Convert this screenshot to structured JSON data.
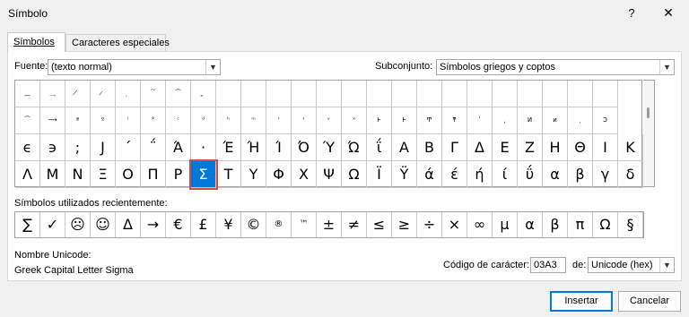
{
  "window": {
    "title": "Símbolo",
    "help": "?",
    "close": "✕"
  },
  "tabs": [
    {
      "label": "Símbolos"
    },
    {
      "label": "Caracteres especiales"
    }
  ],
  "font": {
    "label": "Fuente:",
    "value": "(texto normal)"
  },
  "subset": {
    "label": "Subconjunto:",
    "value": "Símbolos griegos y coptos"
  },
  "grid": {
    "rows": [
      [
        "͟",
        "͢",
        "̸",
        "̷",
        "̹",
        "͠",
        "͡",
        "̪",
        "",
        "",
        "",
        "",
        "",
        "",
        "",
        "",
        "",
        "",
        "",
        "",
        "",
        "",
        "",
        ""
      ],
      [
        "⁀",
        "⟶",
        "ª",
        "º",
        "ⁱ",
        "°",
        "ᶜ",
        "ᵈ",
        "ʰ",
        "ᵐ",
        "ʳ",
        "ᵗ",
        "ᵛ",
        "ˣ",
        "Ⱶ",
        "Ⱶ",
        "Ͳ",
        "ͳ",
        "ʹ",
        "͵",
        "Ͷ",
        "ͷ",
        "ͺ",
        "Ͻ"
      ],
      [
        "ϵ",
        "϶",
        ";",
        "Ϳ",
        "΄",
        "΅",
        "Ά",
        "·",
        "Έ",
        "Ή",
        "Ί",
        "Ό",
        "Ύ",
        "Ώ",
        "ΐ",
        "Α",
        "Β",
        "Γ",
        "Δ",
        "Ε",
        "Ζ",
        "Η",
        "Θ",
        "Ι",
        "Κ"
      ],
      [
        "Λ",
        "Μ",
        "Ν",
        "Ξ",
        "Ο",
        "Π",
        "Ρ",
        "Σ",
        "Τ",
        "Υ",
        "Φ",
        "Χ",
        "Ψ",
        "Ω",
        "Ϊ",
        "Ϋ",
        "ά",
        "έ",
        "ή",
        "ί",
        "ΰ",
        "α",
        "β",
        "γ",
        "δ"
      ]
    ],
    "selected": "Σ"
  },
  "recent": {
    "label": "Símbolos utilizados recientemente:",
    "items": [
      "∑",
      "✓",
      "☹",
      "☺",
      "Δ",
      "→",
      "€",
      "£",
      "¥",
      "©",
      "®",
      "™",
      "±",
      "≠",
      "≤",
      "≥",
      "÷",
      "×",
      "∞",
      "µ",
      "α",
      "β",
      "π",
      "Ω",
      "§"
    ]
  },
  "unicode_name": {
    "label": "Nombre Unicode:",
    "value": "Greek Capital Letter Sigma"
  },
  "char_code": {
    "label": "Código de carácter:",
    "value": "03A3"
  },
  "from": {
    "label": "de:",
    "value": "Unicode (hex)"
  },
  "buttons": {
    "insert": "Insertar",
    "cancel": "Cancelar"
  }
}
